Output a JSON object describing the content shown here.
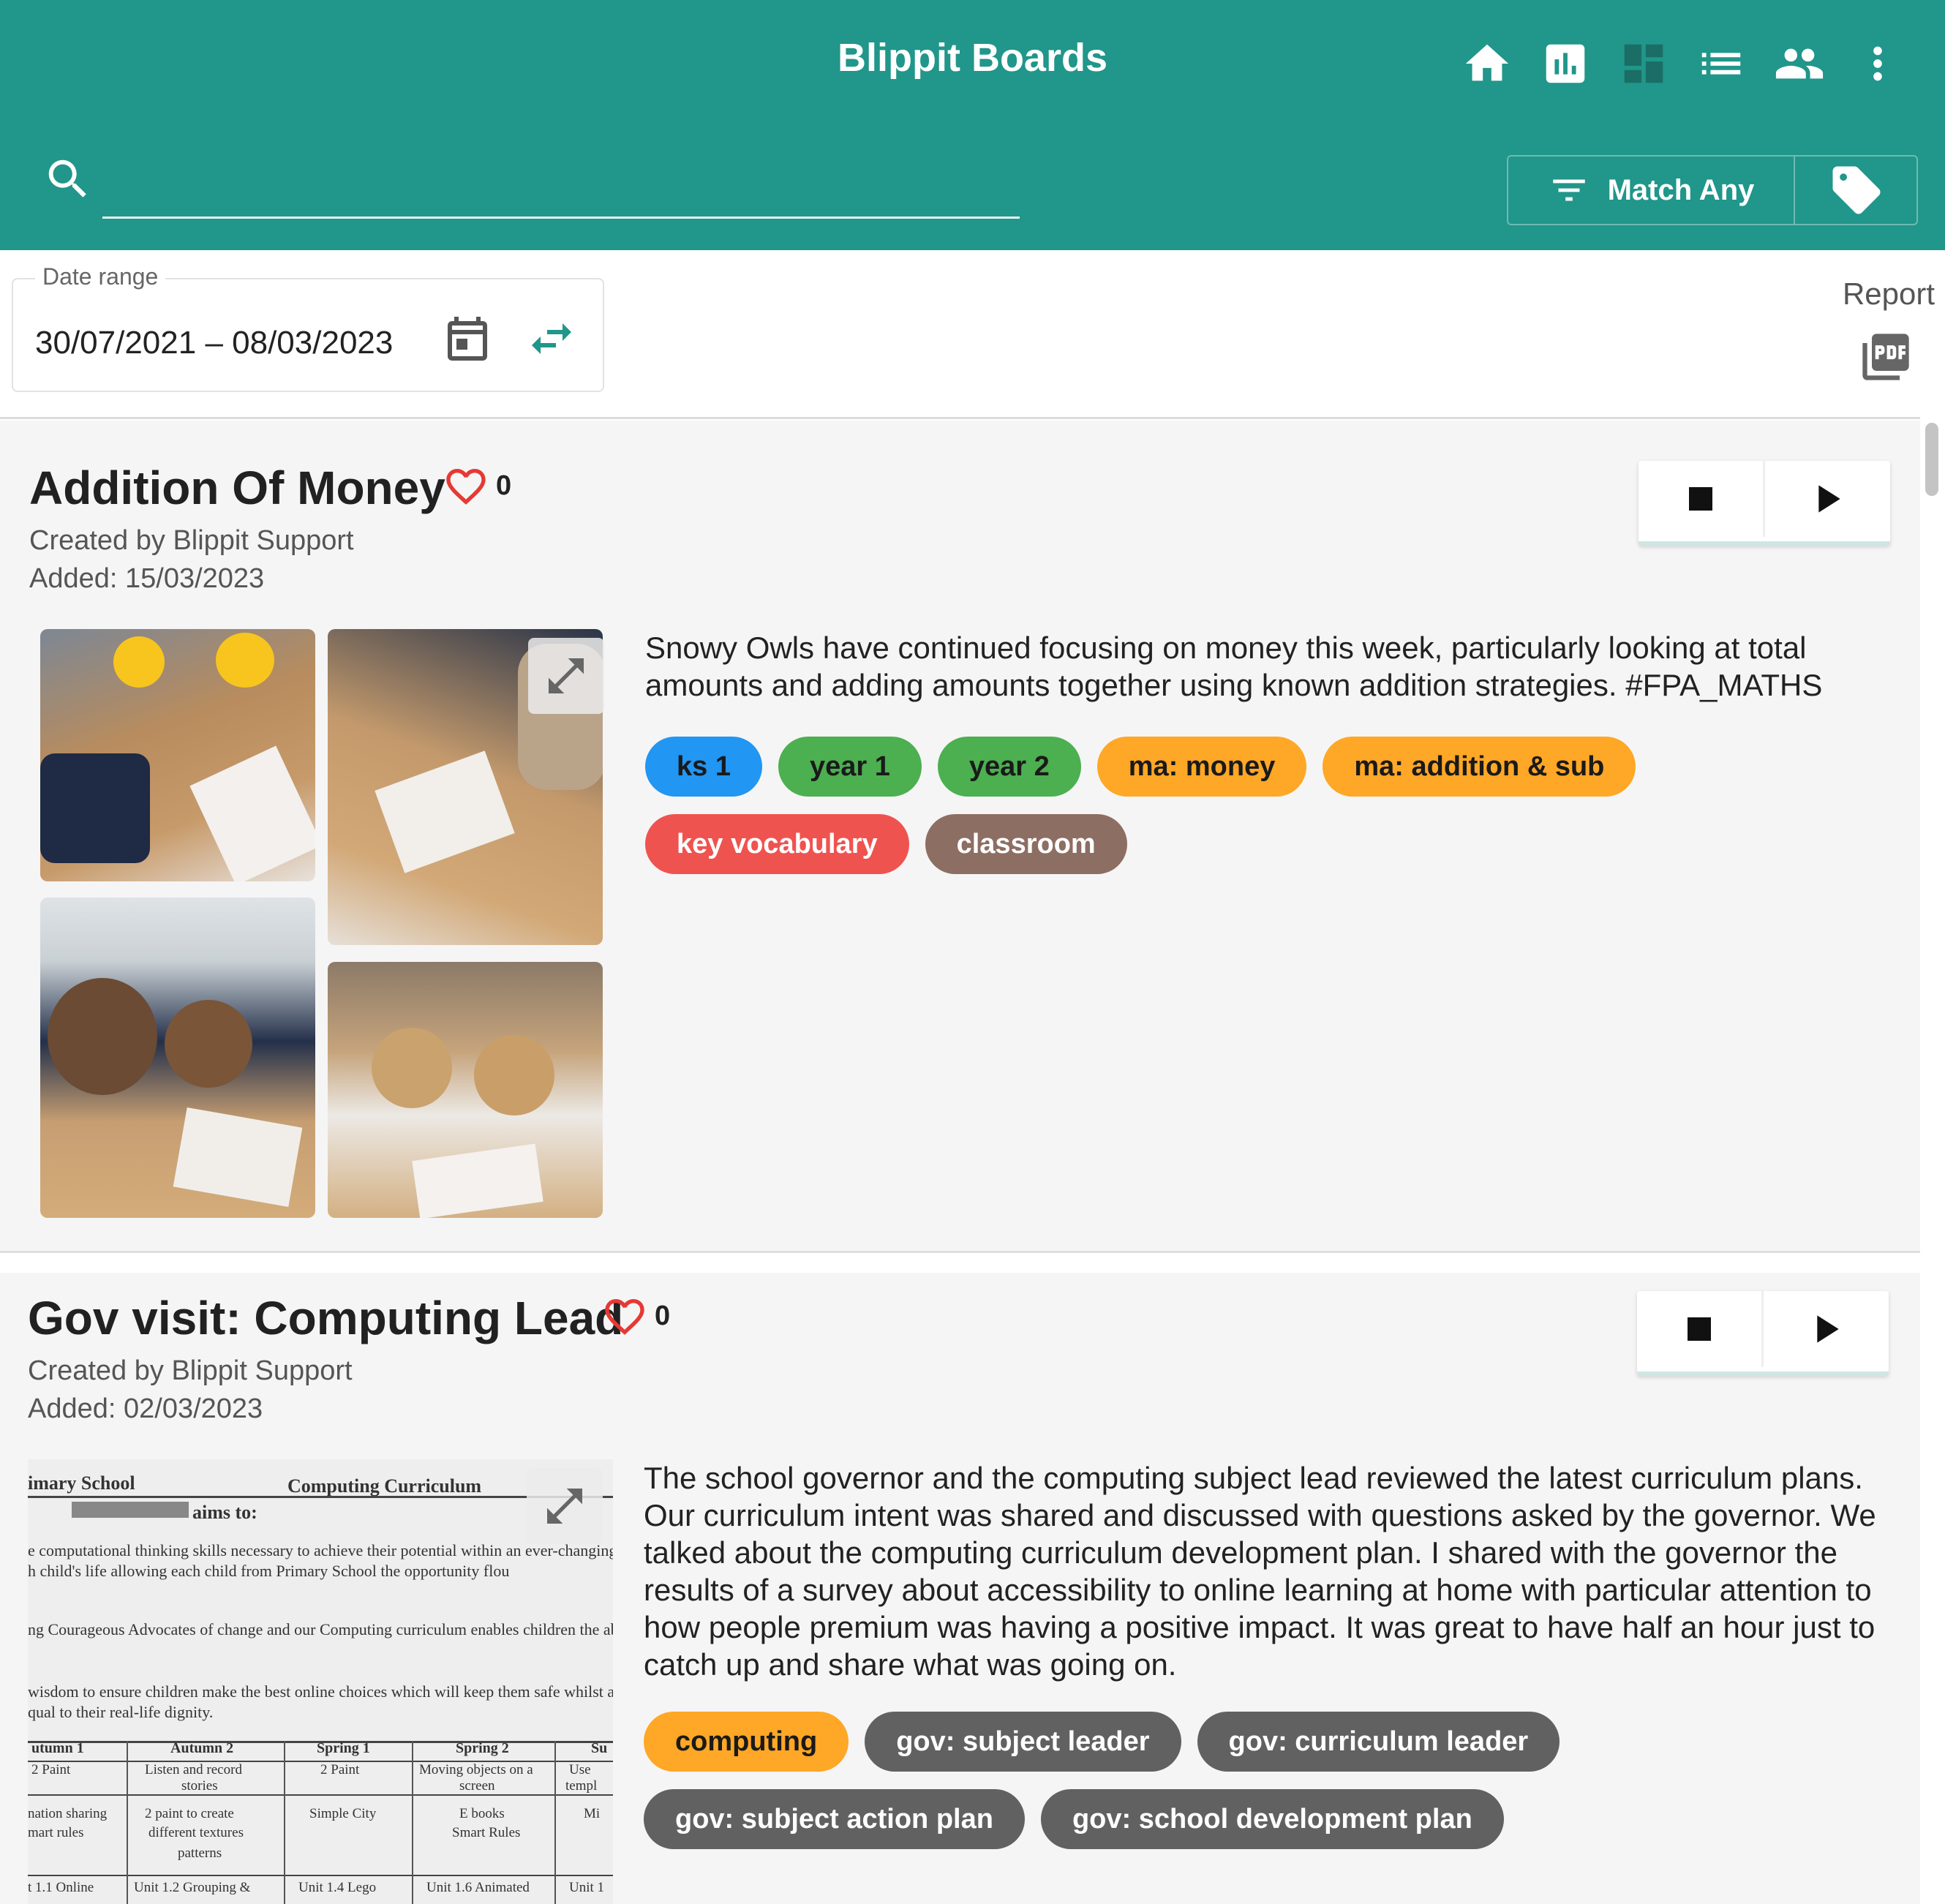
{
  "app": {
    "title": "Blippit Boards",
    "nav_icons": [
      "home-icon",
      "chart-icon",
      "dashboard-icon",
      "list-icon",
      "people-icon",
      "more-vert-icon"
    ]
  },
  "search": {
    "value": "",
    "placeholder": ""
  },
  "filter": {
    "match_label": "Match Any"
  },
  "date_range": {
    "label": "Date range",
    "value": "30/07/2021 – 08/03/2023"
  },
  "report": {
    "label": "Report"
  },
  "colors": {
    "header": "#21968a",
    "blue": "#2196f3",
    "green": "#4caf50",
    "orange": "#ffa726",
    "red": "#ef5350",
    "brown": "#8d6e63",
    "grey": "#616161"
  },
  "posts": [
    {
      "title": "Addition Of Money",
      "likes": "0",
      "created_by": "Created by Blippit Support",
      "added": "Added: 15/03/2023",
      "description": "Snowy Owls have continued focusing on money this week, particularly looking at total amounts and adding amounts together using known addition strategies. #FPA_MATHS",
      "tags": [
        {
          "label": "ks 1",
          "color": "#2196f3",
          "text_color": "#1a1a1a"
        },
        {
          "label": "year 1",
          "color": "#4caf50",
          "text_color": "#1a1a1a"
        },
        {
          "label": "year 2",
          "color": "#4caf50",
          "text_color": "#1a1a1a"
        },
        {
          "label": "ma: money",
          "color": "#ffa726",
          "text_color": "#1a1a1a"
        },
        {
          "label": "ma: addition & sub",
          "color": "#ffa726",
          "text_color": "#1a1a1a"
        },
        {
          "label": "key vocabulary",
          "color": "#ef5350",
          "text_color": "#ffffff"
        },
        {
          "label": "classroom",
          "color": "#8d6e63",
          "text_color": "#ffffff"
        }
      ]
    },
    {
      "title": "Gov visit: Computing Lead",
      "likes": "0",
      "created_by": "Created by Blippit Support",
      "added": "Added: 02/03/2023",
      "description": "The school governor and the computing subject lead reviewed the latest curriculum plans. Our curriculum intent was shared and discussed with questions asked by the governor. We talked about the computing curriculum development plan. I shared with the governor the results of a survey about accessibility to online learning at home with particular attention to how people premium was having a positive impact. It was great to have half an hour just to catch up and share what was going on.",
      "tags": [
        {
          "label": "computing",
          "color": "#ffa726",
          "text_color": "#1a1a1a"
        },
        {
          "label": "gov: subject leader",
          "color": "#616161",
          "text_color": "#ffffff"
        },
        {
          "label": "gov: curriculum leader",
          "color": "#616161",
          "text_color": "#ffffff"
        },
        {
          "label": "gov: subject action plan",
          "color": "#616161",
          "text_color": "#ffffff"
        },
        {
          "label": "gov: school development plan",
          "color": "#616161",
          "text_color": "#ffffff"
        }
      ],
      "document": {
        "school": "imary School",
        "heading": "Computing Curriculum",
        "aims": "aims to:",
        "line1": "e computational thinking skills necessary to achieve their potential within an ever-changing",
        "line2": "h child's life allowing each child from                 Primary School the opportunity flou",
        "line3": "ng Courageous Advocates of change and our Computing curriculum enables children the ab",
        "line4": "wisdom to ensure children make the best online choices which will keep them safe whilst al",
        "line5": "qual to their real-life dignity.",
        "cols": [
          "utumn 1",
          "Autumn 2",
          "Spring 1",
          "Spring 2",
          "Su"
        ],
        "row1": [
          "2 Paint",
          "Listen and record",
          "2 Paint",
          "Moving objects on a",
          "Use"
        ],
        "row1b": [
          "",
          "stories",
          "",
          "screen",
          "templ"
        ],
        "row2": [
          "nation sharing",
          "2 paint to create",
          "Simple City",
          "E books",
          "Mi"
        ],
        "row2b": [
          "mart rules",
          "different textures",
          "",
          "Smart Rules",
          ""
        ],
        "row2c": [
          "",
          "patterns",
          "",
          "",
          ""
        ],
        "row3": [
          "t 1.1 Online",
          "Unit 1.2 Grouping &",
          "Unit 1.4 Lego",
          "Unit 1.6 Animated",
          "Unit 1"
        ]
      }
    }
  ]
}
